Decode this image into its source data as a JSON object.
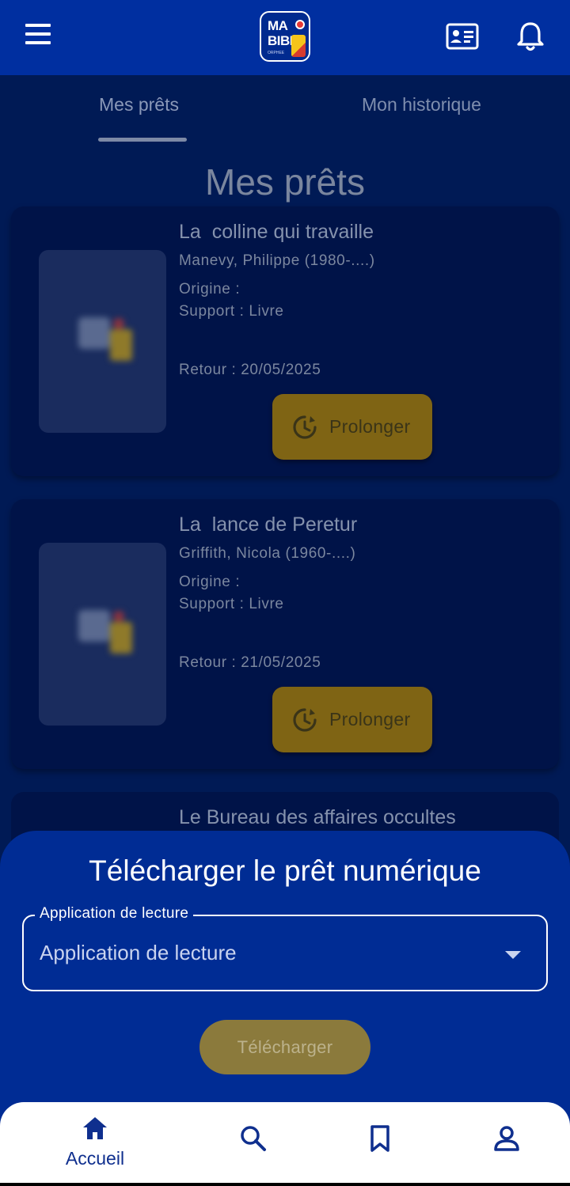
{
  "header": {
    "logo_line1": "MA",
    "logo_line2": "BIBLI",
    "logo_small": "ORPHEE",
    "menu_icon": "menu-icon",
    "card_icon": "id-card-icon",
    "bell_icon": "bell-icon"
  },
  "tabs": [
    {
      "label": "Mes prêts",
      "active": true
    },
    {
      "label": "Mon historique",
      "active": false
    }
  ],
  "page_title": "Mes prêts",
  "loans": [
    {
      "title": "La  colline qui travaille",
      "author": "Manevy, Philippe (1980-....)",
      "origin": "Origine :",
      "support": "Support : Livre",
      "return": "Retour : 20/05/2025",
      "action": "Prolonger"
    },
    {
      "title": "La  lance de Peretur",
      "author": "Griffith, Nicola (1960-....)",
      "origin": "Origine :",
      "support": "Support : Livre",
      "return": "Retour : 21/05/2025",
      "action": "Prolonger"
    },
    {
      "title": "Le Bureau des affaires occultes"
    }
  ],
  "sheet": {
    "title": "Télécharger le prêt numérique",
    "select_label": "Application de lecture",
    "select_value": "Application de lecture",
    "download_label": "Télécharger"
  },
  "nav": [
    {
      "label": "Accueil",
      "icon": "home-icon",
      "active": true
    },
    {
      "label": "",
      "icon": "search-icon"
    },
    {
      "label": "",
      "icon": "bookmark-icon"
    },
    {
      "label": "",
      "icon": "account-icon"
    }
  ],
  "colors": {
    "primary": "#002fa0",
    "accent": "#f5c41a",
    "sheet": "#002c94"
  }
}
